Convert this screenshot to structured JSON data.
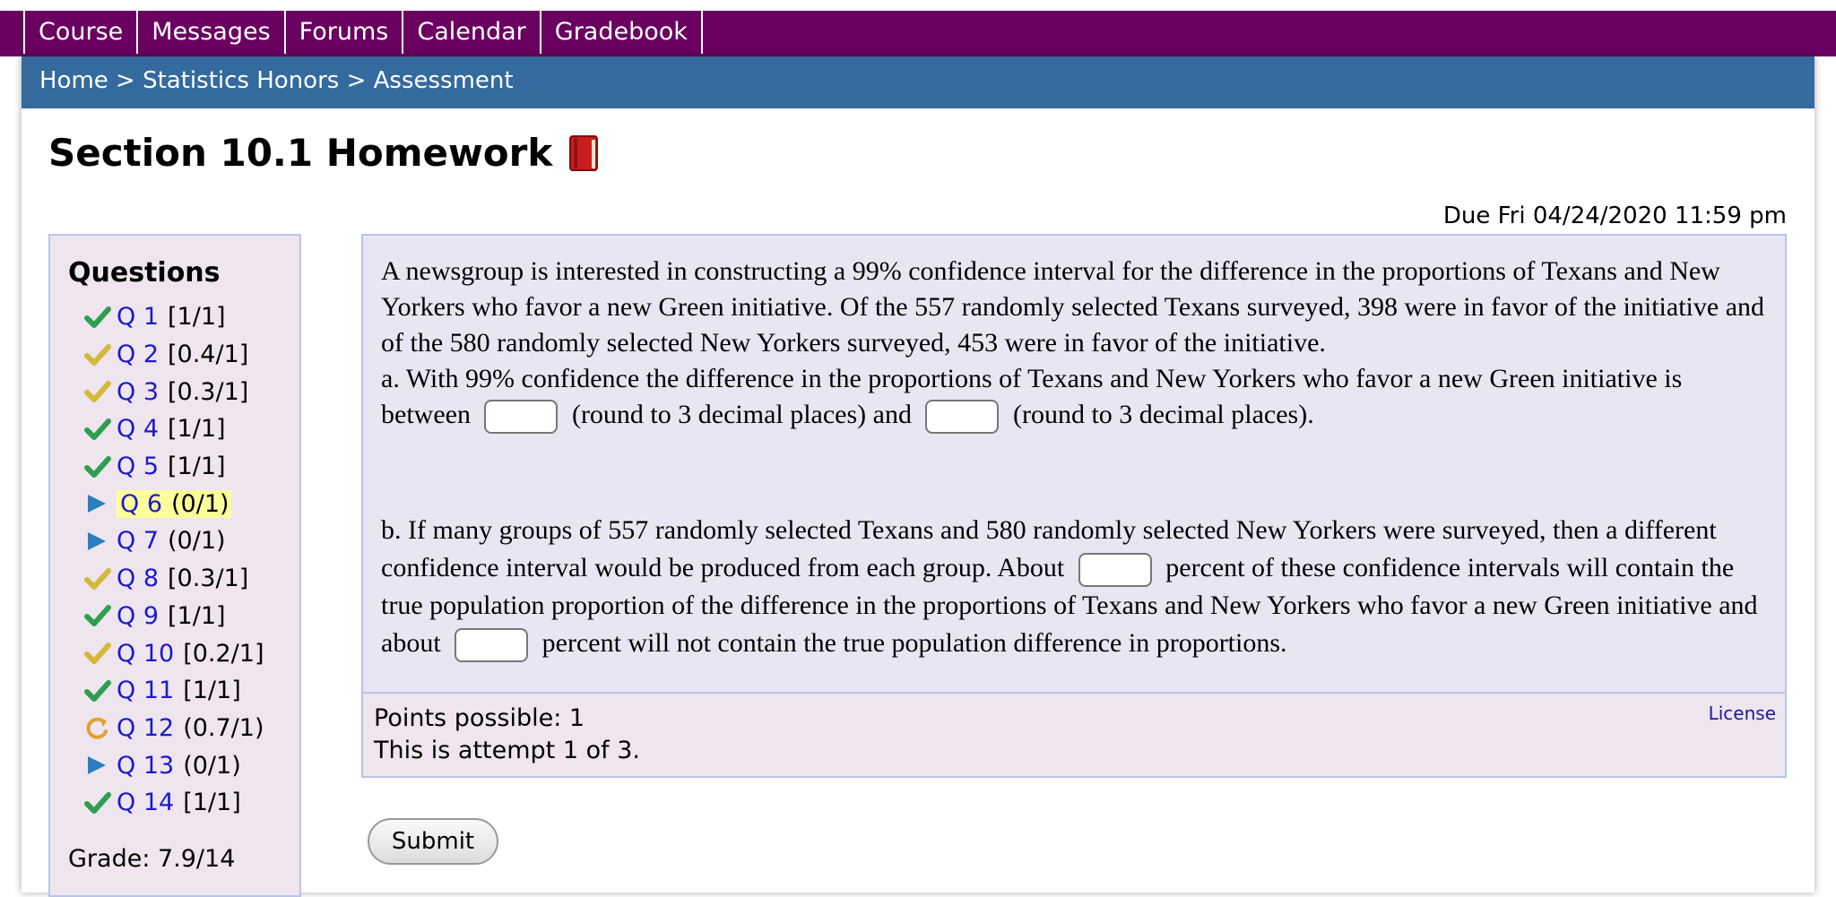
{
  "topnav": {
    "tabs": [
      "Course",
      "Messages",
      "Forums",
      "Calendar",
      "Gradebook"
    ]
  },
  "breadcrumb": {
    "home": "Home",
    "sep1": " > ",
    "course": "Statistics Honors",
    "sep2": " > ",
    "current": "Assessment"
  },
  "page_title": "Section 10.1 Homework",
  "title_icon": "book-icon",
  "due_date": "Due Fri 04/24/2020 11:59 pm",
  "sidebar": {
    "title": "Questions",
    "questions": [
      {
        "label": "Q 1",
        "score": "[1/1]",
        "status": "correct"
      },
      {
        "label": "Q 2",
        "score": "[0.4/1]",
        "status": "partial"
      },
      {
        "label": "Q 3",
        "score": "[0.3/1]",
        "status": "partial"
      },
      {
        "label": "Q 4",
        "score": "[1/1]",
        "status": "correct"
      },
      {
        "label": "Q 5",
        "score": "[1/1]",
        "status": "correct"
      },
      {
        "label": "Q 6",
        "score": "(0/1)",
        "status": "current"
      },
      {
        "label": "Q 7",
        "score": "(0/1)",
        "status": "unattempted"
      },
      {
        "label": "Q 8",
        "score": "[0.3/1]",
        "status": "partial"
      },
      {
        "label": "Q 9",
        "score": "[1/1]",
        "status": "correct"
      },
      {
        "label": "Q 10",
        "score": "[0.2/1]",
        "status": "partial"
      },
      {
        "label": "Q 11",
        "score": "[1/1]",
        "status": "correct"
      },
      {
        "label": "Q 12",
        "score": "(0.7/1)",
        "status": "retry"
      },
      {
        "label": "Q 13",
        "score": "(0/1)",
        "status": "unattempted"
      },
      {
        "label": "Q 14",
        "score": "[1/1]",
        "status": "correct"
      }
    ],
    "grade": "Grade: 7.9/14"
  },
  "question": {
    "intro": "A newsgroup is interested in constructing a 99% confidence interval for the difference in the proportions of Texans and New Yorkers who favor a new Green initiative. Of the 557 randomly selected Texans surveyed, 398 were in favor of the initiative and of the 580 randomly selected New Yorkers surveyed, 453 were in favor of the initiative.",
    "part_a_1": "a.  With 99% confidence the difference in the proportions of Texans and New Yorkers who favor a new Green initiative is between",
    "part_a_2": "(round to 3 decimal places) and",
    "part_a_3": "(round to 3 decimal places).",
    "part_b_1": "b.  If many groups of 557 randomly selected Texans and 580 randomly selected New Yorkers were surveyed, then a different confidence interval would be produced from each group. About",
    "part_b_2": "percent of these confidence intervals will contain the true population proportion of the difference in the proportions of Texans and New Yorkers who favor a new Green initiative and about",
    "part_b_3": "percent will not contain the true population difference in proportions.",
    "inputs": {
      "a_low": "",
      "a_high": "",
      "b_contain": "",
      "b_not_contain": ""
    }
  },
  "points": {
    "possible": "Points possible: 1",
    "attempt": "This is attempt 1 of 3.",
    "license": "License"
  },
  "submit_label": "Submit",
  "colors": {
    "nav_purple": "#6a0060",
    "breadcrumb_blue": "#346a9d",
    "check_green": "#2e9e4f",
    "check_yellow": "#d4b838",
    "arrow_blue": "#2a7fc0",
    "retry_orange": "#e0a030",
    "highlight_yellow": "#ffff99"
  }
}
